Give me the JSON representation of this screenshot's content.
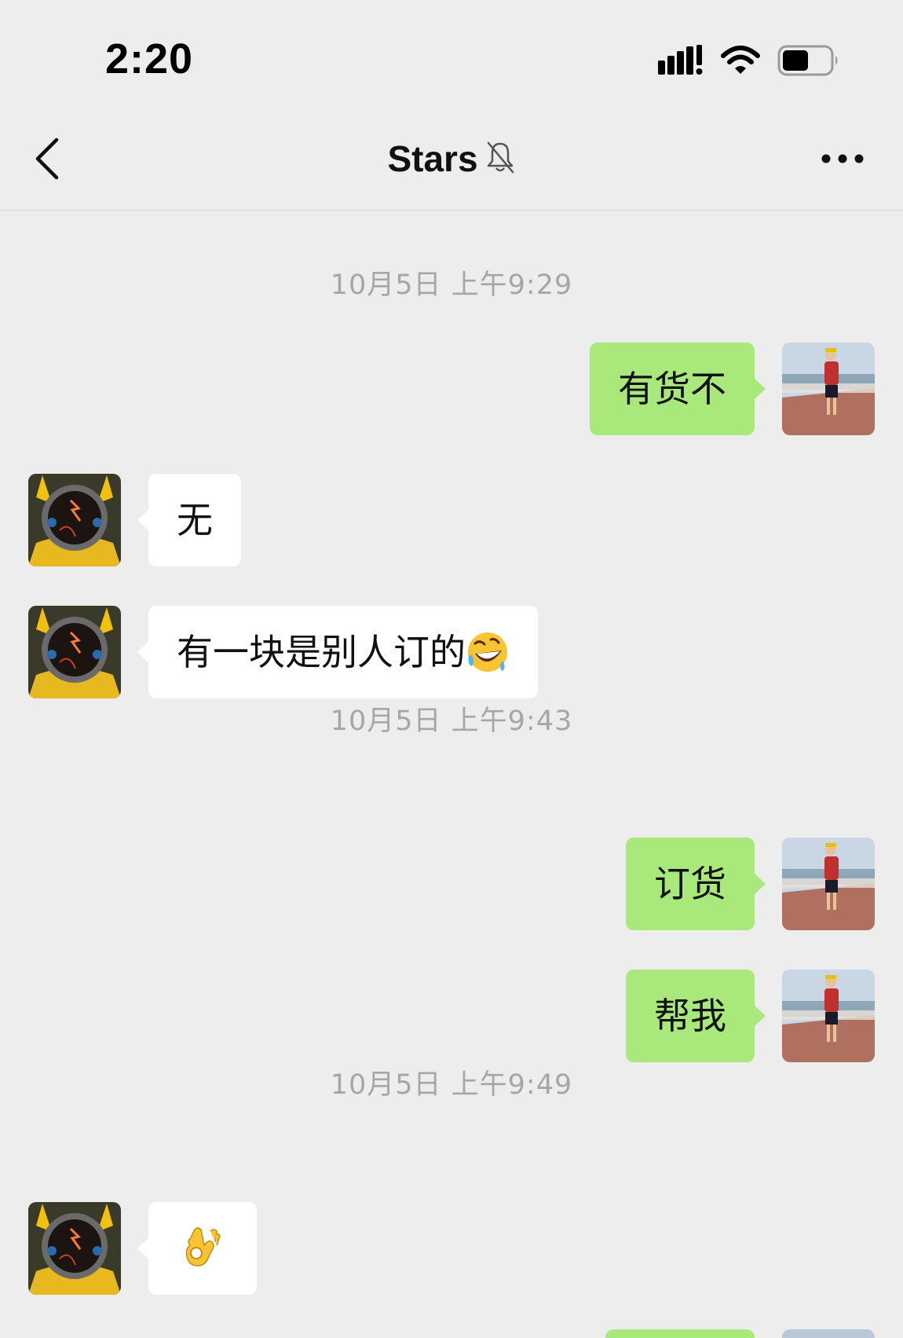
{
  "status_bar": {
    "time": "2:20",
    "icons": [
      "signal-icon",
      "wifi-icon",
      "battery-icon"
    ],
    "battery_level": 0.55
  },
  "nav": {
    "title": "Stars",
    "icons": [
      "back-icon",
      "mute-bell-icon",
      "more-icon"
    ]
  },
  "messages": [
    {
      "type": "time",
      "text": "10月5日 上午9:29"
    },
    {
      "type": "sent",
      "text": "有货不"
    },
    {
      "type": "received",
      "text": "无"
    },
    {
      "type": "received",
      "text": "有一块是别人订的",
      "emoji": "rolling-laughing-emoji"
    },
    {
      "type": "time",
      "text": "10月5日 上午9:43"
    },
    {
      "type": "sent",
      "text": "订货"
    },
    {
      "type": "sent",
      "text": "帮我"
    },
    {
      "type": "time",
      "text": "10月5日 上午9:49"
    },
    {
      "type": "received",
      "text": "",
      "emoji": "ok-hand-emoji"
    }
  ],
  "colors": {
    "background": "#ededed",
    "sent_bubble": "#a9e97c",
    "received_bubble": "#ffffff",
    "timestamp": "#a6a6a6"
  }
}
